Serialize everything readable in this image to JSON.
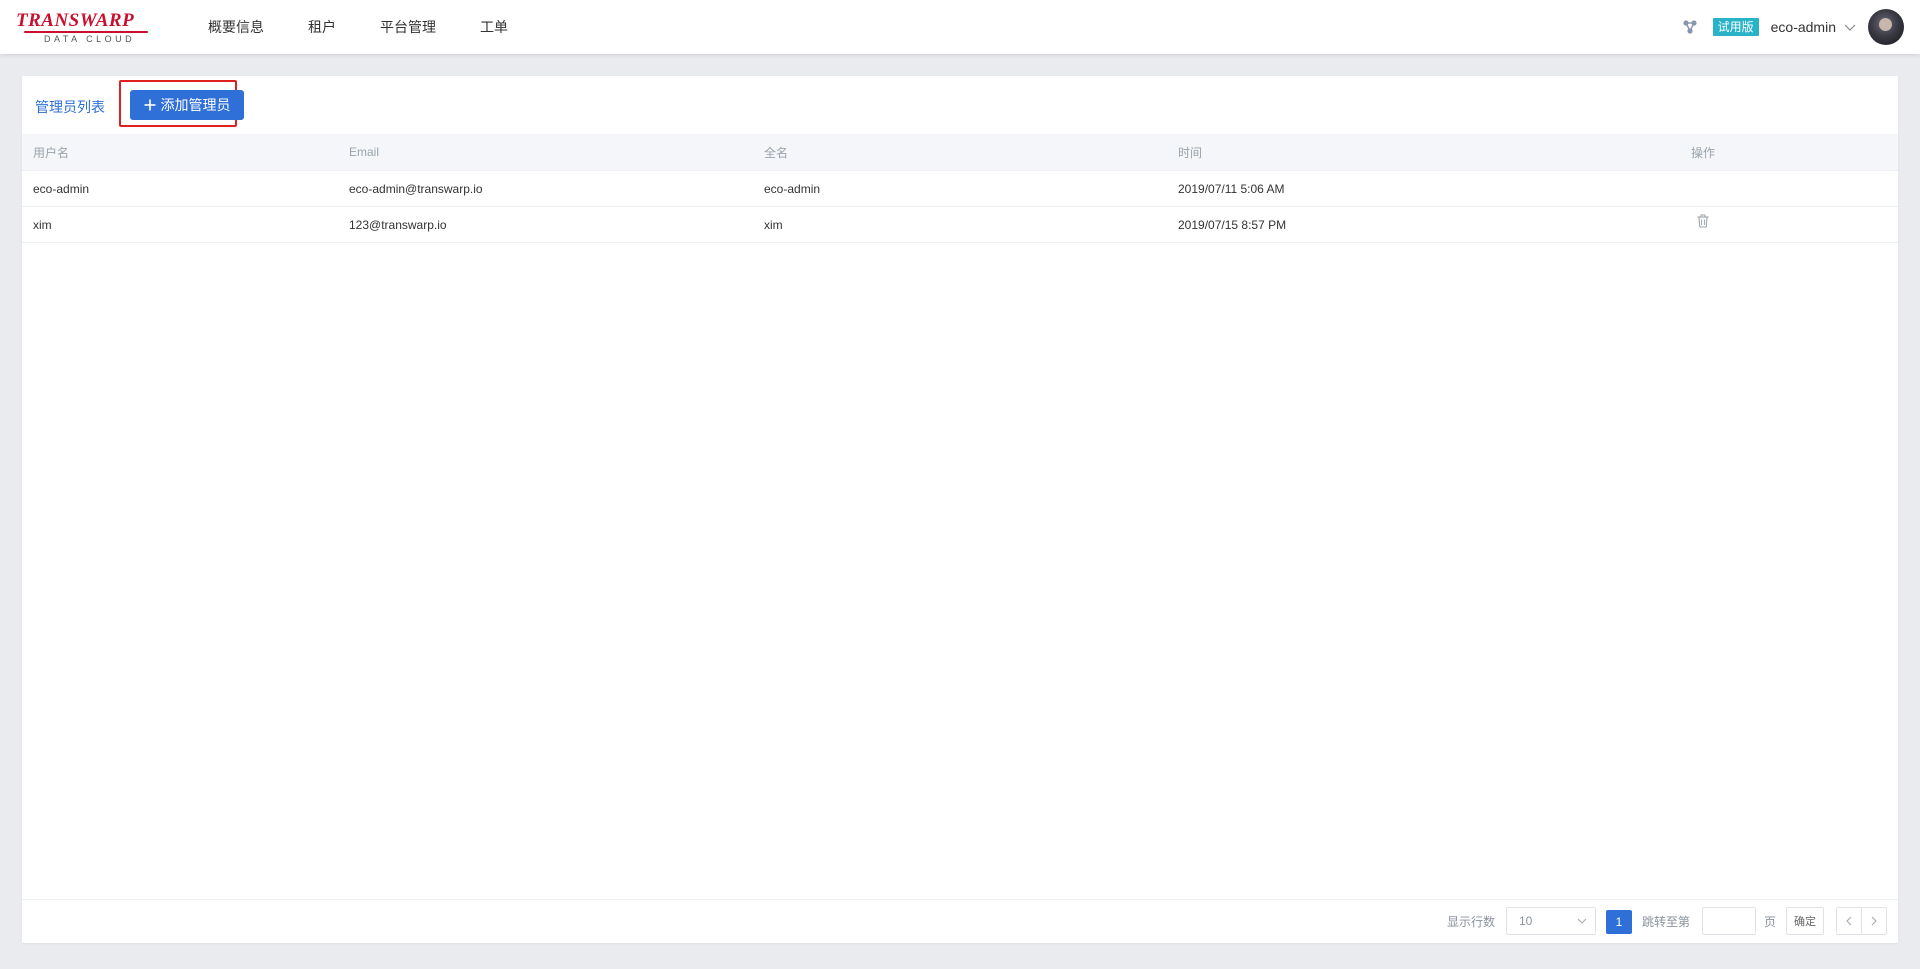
{
  "header": {
    "logo_main": "TRANSWARP",
    "logo_sub": "DATA CLOUD",
    "nav": [
      {
        "label": "概要信息"
      },
      {
        "label": "租户"
      },
      {
        "label": "平台管理"
      },
      {
        "label": "工单"
      }
    ],
    "network_icon": "network-icon",
    "trial_badge": "试用版",
    "user_name": "eco-admin",
    "dropdown_icon": "chevron-down-icon",
    "avatar_icon": "avatar"
  },
  "panel": {
    "title": "管理员列表",
    "add_button_label": "添加管理员",
    "add_icon": "plus-icon",
    "highlight_color": "#e02020"
  },
  "table": {
    "columns": [
      "用户名",
      "Email",
      "全名",
      "时间",
      "操作"
    ],
    "rows": [
      {
        "username": "eco-admin",
        "email": "eco-admin@transwarp.io",
        "fullname": "eco-admin",
        "time": "2019/07/11 5:06 AM",
        "can_delete": false
      },
      {
        "username": "xim",
        "email": "123@transwarp.io",
        "fullname": "xim",
        "time": "2019/07/15 8:57 PM",
        "can_delete": true
      }
    ],
    "delete_icon": "trash-icon"
  },
  "pagination": {
    "rows_label": "显示行数",
    "rows_value": "10",
    "current_page": "1",
    "jump_label": "跳转至第",
    "page_unit": "页",
    "jump_input_value": "",
    "confirm_label": "确定",
    "prev_icon": "chevron-left-icon",
    "next_icon": "chevron-right-icon"
  },
  "colors": {
    "accent": "#2f6fd8",
    "trial_badge_bg": "#28b3c8",
    "brand_red": "#c8102e",
    "page_bg": "#e9ebef"
  }
}
